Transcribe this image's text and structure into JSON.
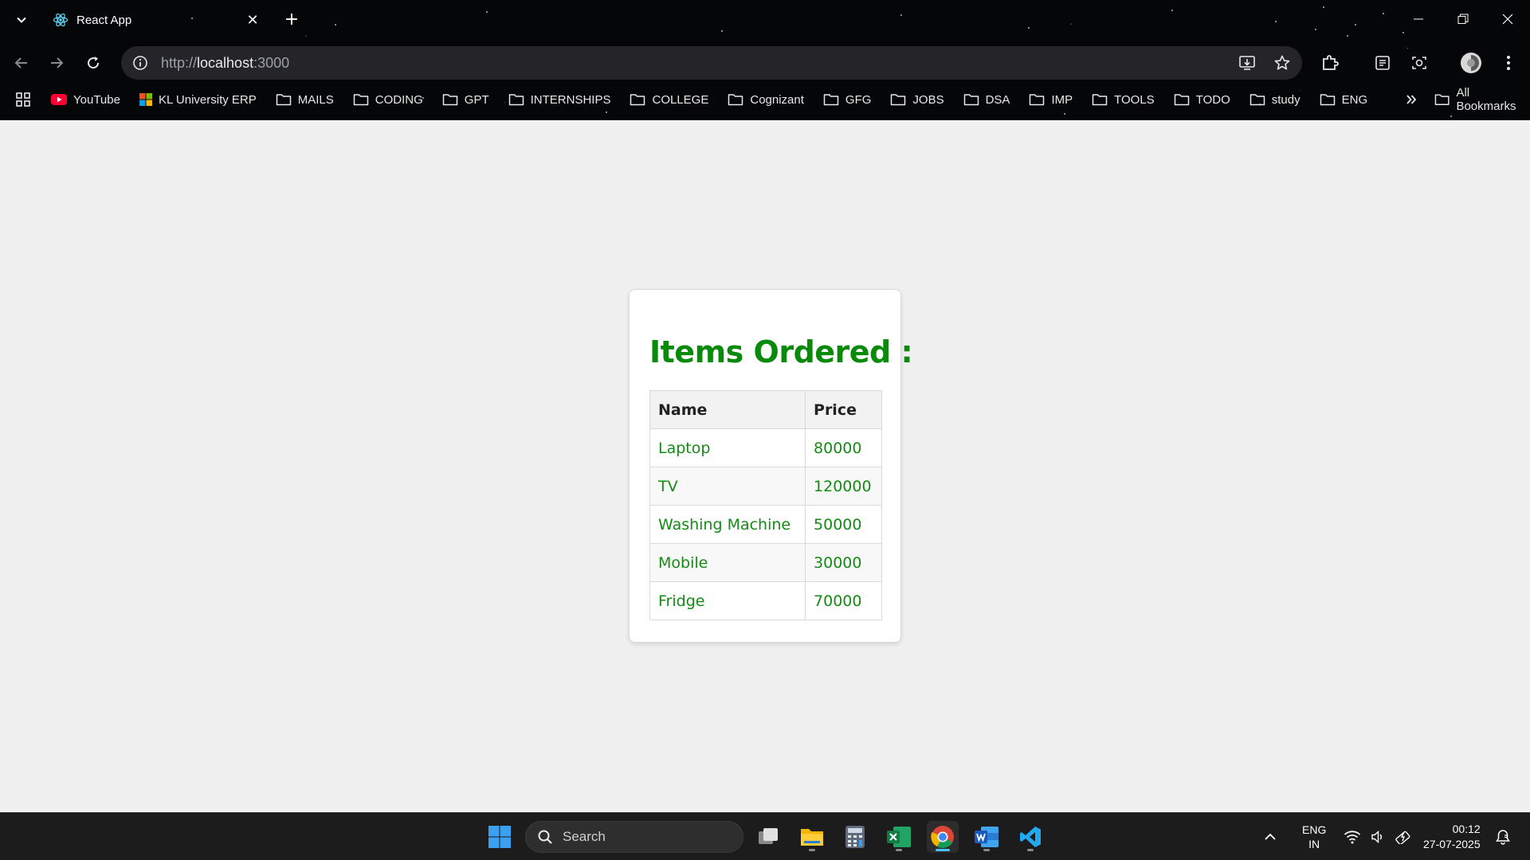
{
  "browser": {
    "tab_title": "React App",
    "url_scheme": "http://",
    "url_host": "localhost",
    "url_port": ":3000"
  },
  "bookmarks": [
    {
      "label": "YouTube",
      "icon": "youtube-icon"
    },
    {
      "label": "KL University ERP",
      "icon": "erp-icon"
    },
    {
      "label": "MAILS",
      "icon": "folder-icon"
    },
    {
      "label": "CODING",
      "icon": "folder-icon"
    },
    {
      "label": "GPT",
      "icon": "folder-icon"
    },
    {
      "label": "INTERNSHIPS",
      "icon": "folder-icon"
    },
    {
      "label": "COLLEGE",
      "icon": "folder-icon"
    },
    {
      "label": "Cognizant",
      "icon": "folder-icon"
    },
    {
      "label": "GFG",
      "icon": "folder-icon"
    },
    {
      "label": "JOBS",
      "icon": "folder-icon"
    },
    {
      "label": "DSA",
      "icon": "folder-icon"
    },
    {
      "label": "IMP",
      "icon": "folder-icon"
    },
    {
      "label": "TOOLS",
      "icon": "folder-icon"
    },
    {
      "label": "TODO",
      "icon": "folder-icon"
    },
    {
      "label": "study",
      "icon": "folder-icon"
    },
    {
      "label": "ENG",
      "icon": "folder-icon"
    }
  ],
  "all_bookmarks_label": "All Bookmarks",
  "page": {
    "heading": "Items Ordered :",
    "columns": [
      "Name",
      "Price"
    ],
    "rows": [
      {
        "name": "Laptop",
        "price": "80000"
      },
      {
        "name": "TV",
        "price": "120000"
      },
      {
        "name": "Washing Machine",
        "price": "50000"
      },
      {
        "name": "Mobile",
        "price": "30000"
      },
      {
        "name": "Fridge",
        "price": "70000"
      }
    ],
    "colors": {
      "heading": "#0a8a0a",
      "cell_text": "#158a15"
    }
  },
  "taskbar": {
    "search_label": "Search",
    "lang_line1": "ENG",
    "lang_line2": "IN",
    "time": "00:12",
    "date": "27-07-2025"
  }
}
